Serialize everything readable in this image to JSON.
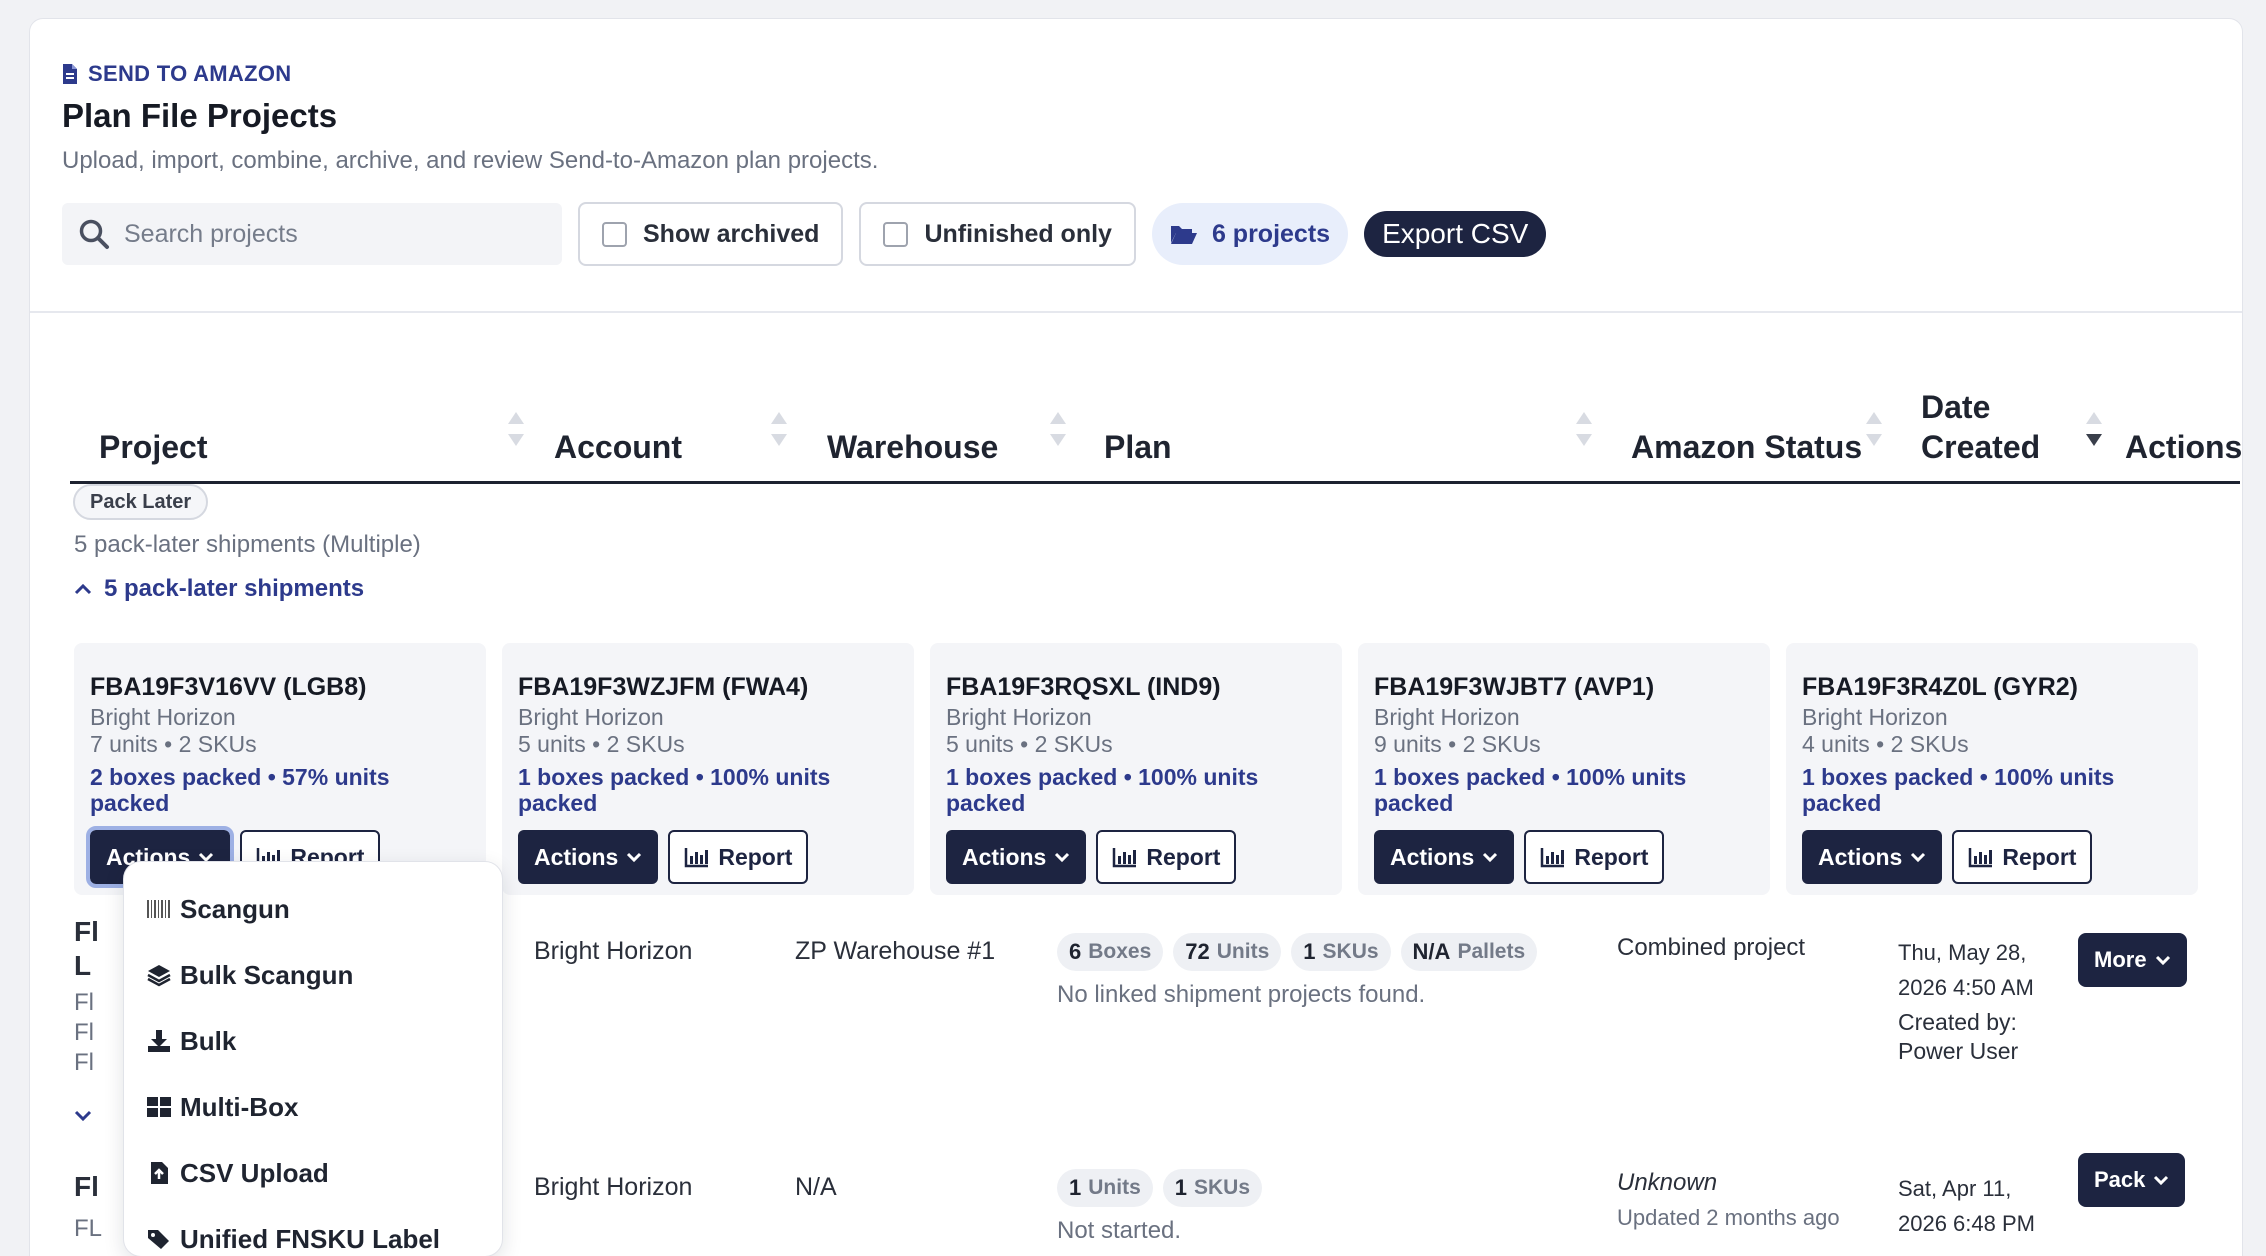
{
  "header": {
    "eyebrow": "SEND TO AMAZON",
    "title": "Plan File Projects",
    "subtitle": "Upload, import, combine, archive, and review Send-to-Amazon plan projects."
  },
  "toolbar": {
    "search_placeholder": "Search projects",
    "show_archived": "Show archived",
    "unfinished_only": "Unfinished only",
    "project_count": "6 projects",
    "export_label": "Export CSV"
  },
  "table": {
    "columns": [
      "Project",
      "Account",
      "Warehouse",
      "Plan",
      "Amazon Status",
      "Date Created",
      "Actions"
    ]
  },
  "group": {
    "tag": "Pack Later",
    "subtitle": "5 pack-later shipments (Multiple)",
    "toggle_label": "5 pack-later shipments",
    "shipments": [
      {
        "id": "FBA19F3V16VV (LGB8)",
        "account": "Bright Horizon",
        "units": "7 units • 2 SKUs",
        "packed": "2 boxes packed • 57% units packed"
      },
      {
        "id": "FBA19F3WZJFM (FWA4)",
        "account": "Bright Horizon",
        "units": "5 units • 2 SKUs",
        "packed": "1 boxes packed • 100% units packed"
      },
      {
        "id": "FBA19F3RQSXL (IND9)",
        "account": "Bright Horizon",
        "units": "5 units • 2 SKUs",
        "packed": "1 boxes packed • 100% units packed"
      },
      {
        "id": "FBA19F3WJBT7 (AVP1)",
        "account": "Bright Horizon",
        "units": "9 units • 2 SKUs",
        "packed": "1 boxes packed • 100% units packed"
      },
      {
        "id": "FBA19F3R4Z0L (GYR2)",
        "account": "Bright Horizon",
        "units": "4 units • 2 SKUs",
        "packed": "1 boxes packed • 100% units packed"
      }
    ],
    "actions_label": "Actions",
    "report_label": "Report"
  },
  "rows": [
    {
      "project_partial": "Fl",
      "project_partial2": "L",
      "project_sub": [
        "Fl",
        "Fl",
        "Fl"
      ],
      "account": "Bright Horizon",
      "warehouse": "ZP Warehouse #1",
      "chips": [
        {
          "value": "6",
          "unit": "Boxes"
        },
        {
          "value": "72",
          "unit": "Units"
        },
        {
          "value": "1",
          "unit": "SKUs"
        },
        {
          "value": "N/A",
          "unit": "Pallets"
        }
      ],
      "plan_note": "No linked shipment projects found.",
      "status": "Combined project",
      "date_line1": "Thu, May 28,",
      "date_line2": "2026 4:50 AM",
      "created_by_label": "Created by:",
      "created_by": "Power User",
      "action_label": "More"
    },
    {
      "project_partial": "Fl",
      "project_sub": "FL",
      "account": "Bright Horizon",
      "warehouse": "N/A",
      "chips": [
        {
          "value": "1",
          "unit": "Units"
        },
        {
          "value": "1",
          "unit": "SKUs"
        }
      ],
      "plan_note": "Not started.",
      "status": "Unknown",
      "status_sub": "Updated 2 months ago",
      "date_line1": "Sat, Apr 11,",
      "date_line2": "2026 6:48 PM",
      "action_label": "Pack"
    }
  ],
  "dropdown": {
    "items": [
      {
        "label": "Scangun",
        "icon": "barcode-icon"
      },
      {
        "label": "Bulk Scangun",
        "icon": "layers-icon"
      },
      {
        "label": "Bulk",
        "icon": "download-icon"
      },
      {
        "label": "Multi-Box",
        "icon": "grid-icon"
      },
      {
        "label": "CSV Upload",
        "icon": "file-upload-icon"
      },
      {
        "label": "Unified FNSKU Label",
        "icon": "tags-icon"
      }
    ]
  },
  "colors": {
    "accent": "#2d3a8c",
    "dark_button": "#1d2441",
    "muted_text": "#6a7180"
  }
}
